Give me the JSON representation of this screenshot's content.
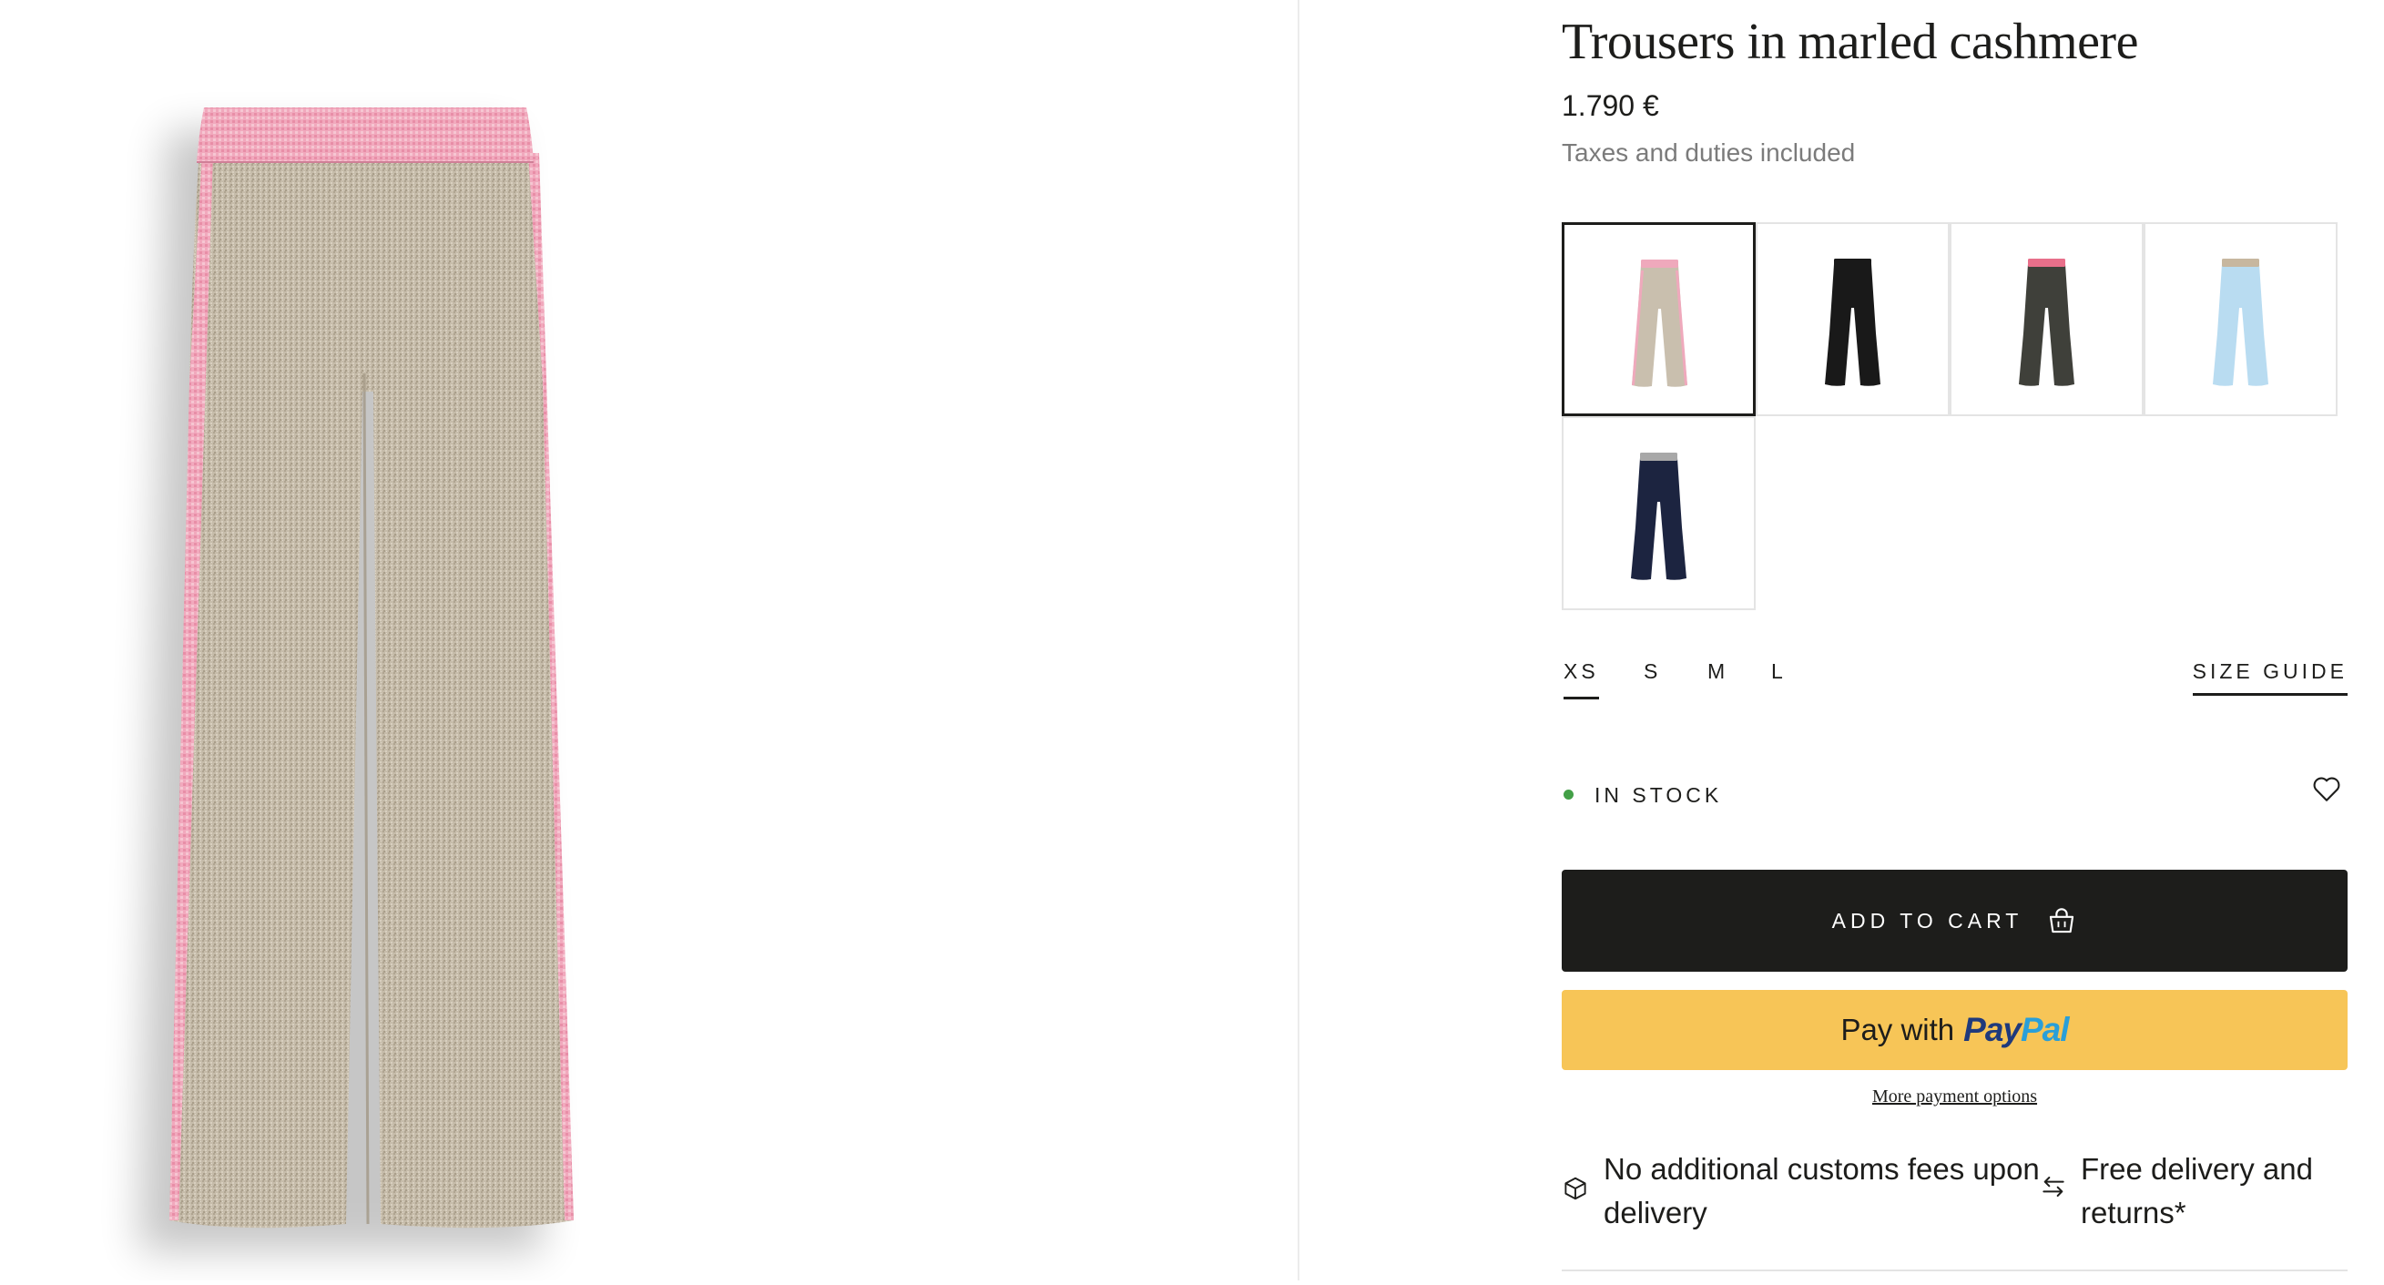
{
  "product": {
    "title": "Trousers in marled cashmere",
    "price": "1.790 €",
    "taxes_note": "Taxes and duties included"
  },
  "color_variants": [
    {
      "icon": "trousers-thumbnail-marled-beige",
      "body": "#c9bfae",
      "waist": "#efa9bc",
      "stripe": "#efa9bc",
      "selected": true
    },
    {
      "icon": "trousers-thumbnail-black",
      "body": "#191919",
      "waist": "#191919",
      "stripe": "#191919",
      "selected": false
    },
    {
      "icon": "trousers-thumbnail-dark-grey",
      "body": "#3f403a",
      "waist": "#e86f8a",
      "stripe": "#3f403a",
      "selected": false
    },
    {
      "icon": "trousers-thumbnail-light-blue",
      "body": "#b9dcf1",
      "waist": "#c7b79f",
      "stripe": "#b9dcf1",
      "selected": false
    },
    {
      "icon": "trousers-thumbnail-navy",
      "body": "#1c2440",
      "waist": "#a8a8a8",
      "stripe": "#1c2440",
      "selected": false
    }
  ],
  "sizes": [
    {
      "label": "XS",
      "selected": true
    },
    {
      "label": "S",
      "selected": false
    },
    {
      "label": "M",
      "selected": false
    },
    {
      "label": "L",
      "selected": false
    }
  ],
  "size_guide_label": "SIZE GUIDE",
  "stock": {
    "label": "IN STOCK",
    "dot_color": "#43a047"
  },
  "wishlist_icon": "heart-outline-icon",
  "add_to_cart": {
    "label": "ADD TO CART",
    "icon": "shopping-bag-icon"
  },
  "paypal": {
    "prefix": "Pay with",
    "brand_pay": "Pay",
    "brand_pal": "Pal"
  },
  "more_payment_options": "More payment options",
  "features": [
    {
      "icon": "package-box-icon",
      "line1": "No additional customs fees upon",
      "line2": "delivery"
    },
    {
      "icon": "exchange-arrows-icon",
      "line1": "Free delivery and",
      "line2": "returns*"
    }
  ],
  "colors": {
    "accent_dark": "#1d1d1b",
    "paypal_yellow": "#f7c557",
    "paypal_navy": "#1f3a7c",
    "paypal_blue": "#2a9fd8",
    "muted_text": "#7b7b7b"
  }
}
